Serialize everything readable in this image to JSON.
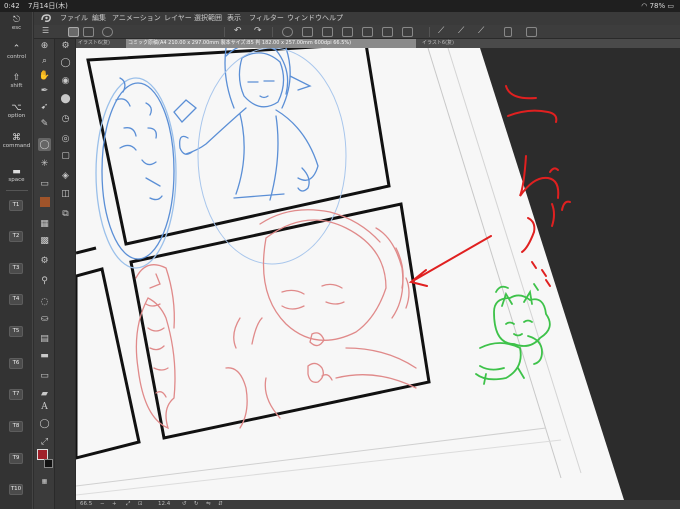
{
  "status": {
    "time": "0:42",
    "date": "7月14日(木)",
    "battery": "78%"
  },
  "menu": [
    "ファイル",
    "編集",
    "アニメーション",
    "レイヤー",
    "選択範囲",
    "表示",
    "フィルター",
    "ウィンドウ",
    "ヘルプ"
  ],
  "tabs": [
    "イラスト6(复)",
    "コミック原稿(A4 210.00 x 297.00mm 製本サイズ:B5 判 182.00 x 257.00mm 600dpi 66.5%)",
    "イラスト6(复)"
  ],
  "modifiers": {
    "esc": "esc",
    "control": "control",
    "shift": "shift",
    "option": "option",
    "command": "command",
    "space": "space"
  },
  "tkeys": [
    "T1",
    "T2",
    "T3",
    "T4",
    "T5",
    "T6",
    "T7",
    "T8",
    "T9",
    "T10"
  ],
  "bottom": {
    "zoom": "66.5",
    "angle": "12.4"
  },
  "colors": {
    "main": "#a0202a",
    "sub": "#111111",
    "blue_sketch": "#5b8fd6",
    "pink_sketch": "#e08a8a",
    "red_note": "#e02020",
    "green_doodle": "#3ec24a"
  }
}
